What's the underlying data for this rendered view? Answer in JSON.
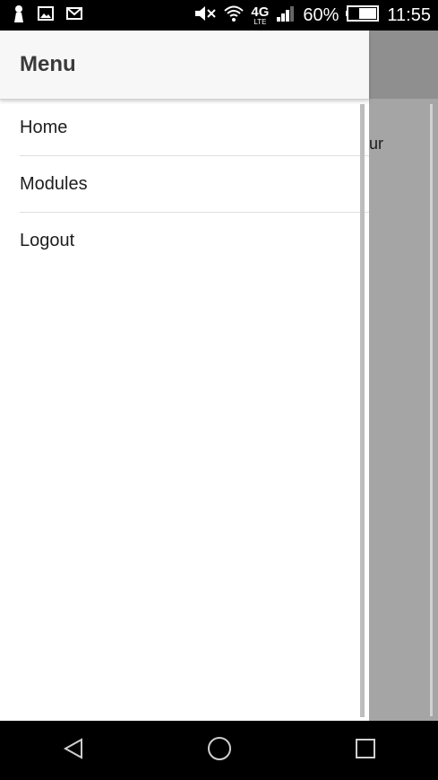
{
  "status_bar": {
    "left_icons": [
      "profile-icon",
      "gallery-icon",
      "gmail-icon"
    ],
    "right_icons": [
      "mute-icon",
      "wifi-icon",
      "lte-icon",
      "signal-icon",
      "battery-icon"
    ],
    "network_label": "4G",
    "network_sub": "LTE",
    "battery_percent": "60%",
    "battery_level": 0.6,
    "time": "11:55"
  },
  "drawer": {
    "title": "Menu",
    "items": [
      {
        "label": "Home"
      },
      {
        "label": "Modules"
      },
      {
        "label": "Logout"
      }
    ]
  },
  "background": {
    "peek_text": "ur"
  },
  "navbar": {
    "buttons": [
      "back-icon",
      "home-icon",
      "recents-icon"
    ]
  }
}
